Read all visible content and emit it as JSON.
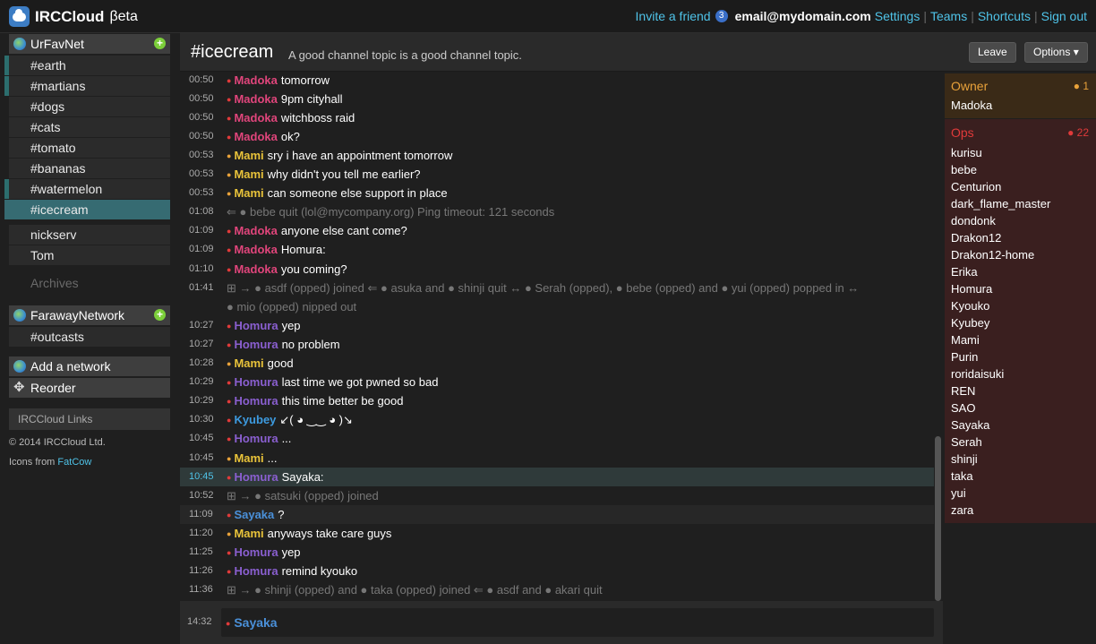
{
  "header": {
    "app_name": "IRCCloud",
    "beta": "βeta",
    "invite_label": "Invite a friend",
    "invite_count": "3",
    "email": "email@mydomain.com",
    "nav": [
      "Settings",
      "Teams",
      "Shortcuts",
      "Sign out"
    ]
  },
  "sidebar": {
    "networks": [
      {
        "name": "UrFavNet",
        "channels": [
          "#earth",
          "#martians",
          "#dogs",
          "#cats",
          "#tomato",
          "#bananas",
          "#watermelon",
          "#icecream"
        ],
        "queries": [
          "nickserv",
          "Tom"
        ],
        "archives": "Archives"
      },
      {
        "name": "FarawayNetwork",
        "channels": [
          "#outcasts"
        ]
      }
    ],
    "add_network": "Add a network",
    "reorder": "Reorder",
    "links": "IRCCloud Links",
    "copyright": "© 2014 IRCCloud Ltd.",
    "icons_from": "Icons from",
    "icons_link": "FatCow"
  },
  "channel": {
    "name": "#icecream",
    "topic": "A good channel topic is a good channel topic.",
    "leave": "Leave",
    "options": "Options ▾"
  },
  "colors": {
    "Madoka": "#e0457b",
    "Mami": "#e9c33a",
    "Homura": "#8a5fd0",
    "Kyubey": "#3d9be0",
    "Sayaka": "#4a90d9",
    "dot_red": "#e03a3a",
    "dot_yellow": "#e9a23a"
  },
  "messages": [
    {
      "t": "00:50",
      "nick": "Madoka",
      "text": "tomorrow"
    },
    {
      "t": "00:50",
      "nick": "Madoka",
      "text": "9pm cityhall"
    },
    {
      "t": "00:50",
      "nick": "Madoka",
      "text": "witchboss raid"
    },
    {
      "t": "00:50",
      "nick": "Madoka",
      "text": "ok?"
    },
    {
      "t": "00:53",
      "nick": "Mami",
      "text": "sry i have an appointment tomorrow"
    },
    {
      "t": "00:53",
      "nick": "Mami",
      "text": "why didn't you tell me earlier?"
    },
    {
      "t": "00:53",
      "nick": "Mami",
      "text": "can someone else support in place"
    },
    {
      "t": "01:08",
      "sys": "⇐ ● bebe quit (lol@mycompany.org) Ping timeout: 121 seconds"
    },
    {
      "t": "01:09",
      "nick": "Madoka",
      "text": "anyone else cant come?"
    },
    {
      "t": "01:09",
      "nick": "Madoka",
      "text": "Homura:"
    },
    {
      "t": "01:10",
      "nick": "Madoka",
      "text": "you coming?"
    },
    {
      "t": "01:41",
      "sys": "⊞ → ● asdf (opped) joined  ⇐ ● asuka and ● shinji quit  ↔ ● Serah (opped), ● bebe (opped) and ● yui (opped) popped in  ↔"
    },
    {
      "t": "",
      "sys": "● mio (opped) nipped out"
    },
    {
      "t": "10:27",
      "nick": "Homura",
      "text": "yep"
    },
    {
      "t": "10:27",
      "nick": "Homura",
      "text": "no problem"
    },
    {
      "t": "10:28",
      "nick": "Mami",
      "text": "good"
    },
    {
      "t": "10:29",
      "nick": "Homura",
      "text": "last time we got pwned so bad"
    },
    {
      "t": "10:29",
      "nick": "Homura",
      "text": "this time better be good"
    },
    {
      "t": "10:30",
      "nick": "Kyubey",
      "text": "↙( ◕ ‿‿ ◕ )↘"
    },
    {
      "t": "10:45",
      "nick": "Homura",
      "text": "..."
    },
    {
      "t": "10:45",
      "nick": "Mami",
      "text": "..."
    },
    {
      "t": "10:45",
      "nick": "Homura",
      "text": "Sayaka:"
    },
    {
      "t": "10:52",
      "sys": "⊞ → ● satsuki (opped) joined"
    },
    {
      "t": "11:09",
      "nick": "Sayaka",
      "text": "?"
    },
    {
      "t": "11:20",
      "nick": "Mami",
      "text": "anyways take care guys"
    },
    {
      "t": "11:25",
      "nick": "Homura",
      "text": "yep"
    },
    {
      "t": "11:26",
      "nick": "Homura",
      "text": "remind kyouko"
    },
    {
      "t": "11:36",
      "sys": "⊞ → ● shinji (opped) and ● taka (opped) joined  ⇐ ● asdf and ● akari quit"
    }
  ],
  "input": {
    "time": "14:32",
    "nick": "Sayaka"
  },
  "members": {
    "owner_label": "Owner",
    "owner_count": "● 1",
    "owners": [
      "Madoka"
    ],
    "ops_label": "Ops",
    "ops_count": "● 22",
    "ops": [
      "kurisu",
      "bebe",
      "Centurion",
      "dark_flame_master",
      "dondonk",
      "Drakon12",
      "Drakon12-home",
      "Erika",
      "Homura",
      "Kyouko",
      "Kyubey",
      "Mami",
      "Purin",
      "roridaisuki",
      "REN",
      "SAO",
      "Sayaka",
      "Serah",
      "shinji",
      "taka",
      "yui",
      "zara"
    ]
  }
}
